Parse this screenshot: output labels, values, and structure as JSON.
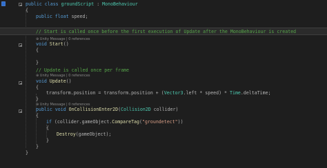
{
  "editor": {
    "lines": [
      {
        "id": "class-decl",
        "parts": [
          [
            "kw",
            "public class "
          ],
          [
            "ty",
            "groundScript"
          ],
          [
            "op",
            " : "
          ],
          [
            "ty",
            "MonoBehaviour"
          ]
        ]
      },
      {
        "id": "brace-open-class",
        "parts": [
          [
            "op",
            "{"
          ]
        ]
      },
      {
        "id": "field-speed",
        "parts": [
          [
            "kw",
            "public float "
          ],
          [
            "op",
            "speed;"
          ]
        ]
      },
      {
        "id": "blank-1",
        "parts": []
      },
      {
        "id": "comment-start",
        "parts": [
          [
            "cm",
            "// Start is called once before the first execution of Update after the MonoBehaviour is created"
          ]
        ]
      },
      {
        "id": "start-decl",
        "parts": [
          [
            "kw",
            "void "
          ],
          [
            "fn",
            "Start"
          ],
          [
            "op",
            "()"
          ]
        ]
      },
      {
        "id": "brace-open-start",
        "parts": [
          [
            "op",
            "{"
          ]
        ]
      },
      {
        "id": "blank-2",
        "parts": []
      },
      {
        "id": "brace-close-start",
        "parts": [
          [
            "op",
            "}"
          ]
        ]
      },
      {
        "id": "blank-3",
        "parts": []
      },
      {
        "id": "comment-update",
        "parts": [
          [
            "cm",
            "// Update is called once per frame"
          ]
        ]
      },
      {
        "id": "update-decl",
        "parts": [
          [
            "kw",
            "void "
          ],
          [
            "fn",
            "Update"
          ],
          [
            "op",
            "()"
          ]
        ]
      },
      {
        "id": "brace-open-update",
        "parts": [
          [
            "op",
            "{"
          ]
        ]
      },
      {
        "id": "transform-line",
        "parts": [
          [
            "op",
            "transform.position = transform.position + ("
          ],
          [
            "ty",
            "Vector3"
          ],
          [
            "op",
            ".left * speed) * "
          ],
          [
            "ty",
            "Time"
          ],
          [
            "op",
            ".deltaTime;"
          ]
        ]
      },
      {
        "id": "brace-close-update",
        "parts": [
          [
            "op",
            "}"
          ]
        ]
      },
      {
        "id": "collision-decl",
        "parts": [
          [
            "kw",
            "public void "
          ],
          [
            "fn",
            "OnCollisionEnter2D"
          ],
          [
            "op",
            "("
          ],
          [
            "ty",
            "Collision2D"
          ],
          [
            "op",
            " collider)"
          ]
        ]
      },
      {
        "id": "brace-open-collision",
        "parts": [
          [
            "op",
            "{"
          ]
        ]
      },
      {
        "id": "if-line",
        "parts": [
          [
            "kw",
            "if "
          ],
          [
            "op",
            "(collider.gameObject."
          ],
          [
            "fn",
            "CompareTag"
          ],
          [
            "op",
            "("
          ],
          [
            "str",
            "\"groundetect\""
          ],
          [
            "op",
            "))"
          ]
        ]
      },
      {
        "id": "brace-open-if",
        "parts": [
          [
            "op",
            "{"
          ]
        ]
      },
      {
        "id": "destroy-line",
        "parts": [
          [
            "fn",
            "Destroy"
          ],
          [
            "op",
            "(gameObject);"
          ]
        ]
      },
      {
        "id": "brace-close-if",
        "parts": [
          [
            "op",
            "}"
          ]
        ]
      },
      {
        "id": "brace-close-collision",
        "parts": [
          [
            "op",
            "}"
          ]
        ]
      },
      {
        "id": "brace-close-class",
        "parts": [
          [
            "op",
            "}"
          ]
        ]
      }
    ],
    "codelens": {
      "start": "⊕ Unity Message | 0 references",
      "update": "⊕ Unity Message | 0 references",
      "collision": "⊕ Unity Message | 0 references"
    }
  },
  "colors": {
    "background": "#1e1e1e",
    "keyword": "#569cd6",
    "type": "#4ec9b0",
    "method": "#dcdcaa",
    "string": "#d69d85",
    "comment": "#57a64a",
    "text": "#dcdcdc"
  },
  "icons": [
    "bookmark-icon",
    "lightbulb-icon",
    "collapse-icon"
  ]
}
